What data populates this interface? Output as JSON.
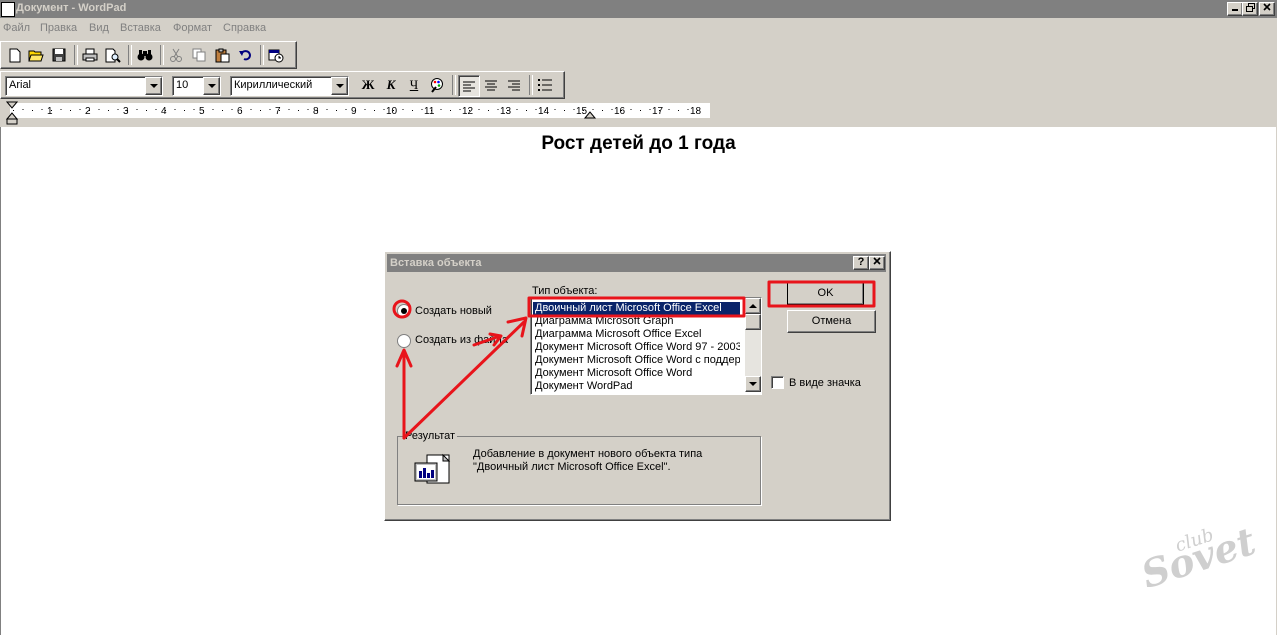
{
  "window": {
    "title": "Документ - WordPad",
    "controls": [
      "_",
      "⧉",
      "✕"
    ]
  },
  "menu": [
    "Файл",
    "Правка",
    "Вид",
    "Вставка",
    "Формат",
    "Справка"
  ],
  "format_bar": {
    "font": "Arial",
    "size": "10",
    "script": "Кириллический",
    "bold": "Ж",
    "italic": "К",
    "underline": "Ч"
  },
  "ruler": {
    "ticks": [
      "1",
      "2",
      "3",
      "4",
      "5",
      "6",
      "7",
      "8",
      "9",
      "10",
      "11",
      "12",
      "13",
      "14",
      "15",
      "16",
      "17",
      "18"
    ]
  },
  "document": {
    "heading": "Рост детей до 1 года"
  },
  "dialog": {
    "title": "Вставка объекта",
    "help": "?",
    "close": "✕",
    "radio_create_new": "Создать новый",
    "radio_from_file": "Создать из файла",
    "object_type_label": "Тип объекта:",
    "object_types": [
      "Двоичный лист Microsoft Office Excel",
      "Диаграмма Microsoft Graph",
      "Диаграмма Microsoft Office Excel",
      "Документ Microsoft Office Word 97 - 2003",
      "Документ Microsoft Office Word с поддержкой",
      "Документ Microsoft Office Word",
      "Документ WordPad"
    ],
    "selected_index": 0,
    "ok": "OK",
    "cancel": "Отмена",
    "as_icon": "В виде значка",
    "result_label": "Результат",
    "result_line1": "Добавление в документ нового объекта типа",
    "result_line2": "\"Двоичный лист Microsoft Office Excel\"."
  },
  "watermark": {
    "small": "club",
    "large": "Sovet"
  },
  "colors": {
    "chrome": "#d4d0c8",
    "titlebar_inactive": "#808080",
    "selection": "#0a246a",
    "annotation": "#e8141b"
  }
}
